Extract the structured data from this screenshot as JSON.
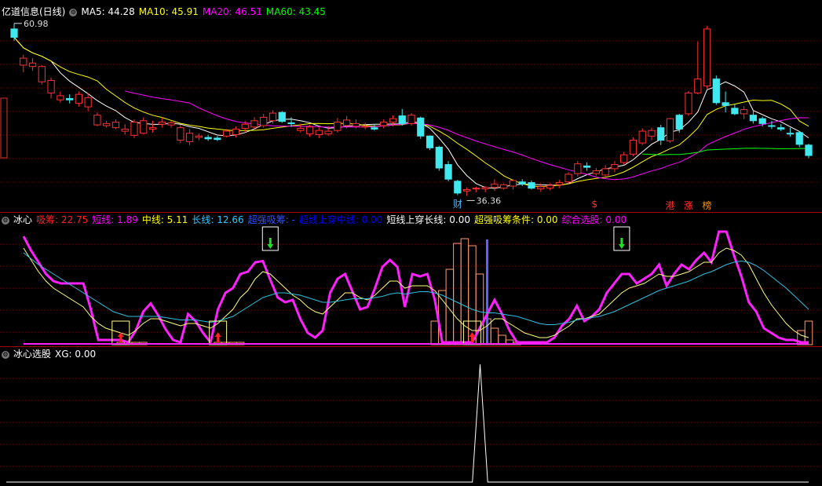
{
  "main_panel": {
    "title": "亿道信息(日线)",
    "indicators": [
      {
        "label": "MA5: 44.28",
        "color": "#ffffff"
      },
      {
        "label": "MA10: 45.91",
        "color": "#ffff00"
      },
      {
        "label": "MA20: 46.51",
        "color": "#ff00ff"
      },
      {
        "label": "MA60: 43.45",
        "color": "#00ff00"
      }
    ],
    "high_label": "60.98",
    "low_label": "36.36",
    "markers": [
      {
        "text": "财",
        "color": "#4db8ff"
      },
      {
        "text": "$",
        "color": "#ff3030"
      },
      {
        "text": "港",
        "color": "#ff3030"
      },
      {
        "text": "涨",
        "color": "#ff3030"
      },
      {
        "text": "榜",
        "color": "#ff9000"
      }
    ]
  },
  "sub_panel_1": {
    "title": "冰心",
    "indicators": [
      {
        "label": "吸筹: 22.75",
        "color": "#ff2020"
      },
      {
        "label": "短线: 1.89",
        "color": "#ff00ff"
      },
      {
        "label": "中线: 5.11",
        "color": "#ffff00"
      },
      {
        "label": "长线: 12.66",
        "color": "#30c8ff"
      },
      {
        "label": "超强吸筹: -",
        "color": "#3050ff"
      },
      {
        "label": "超线上穿中线: 0.00",
        "color": "#0000ff"
      },
      {
        "label": "短线上穿长线: 0.00",
        "color": "#ffffff"
      },
      {
        "label": "超强吸筹条件: 0.00",
        "color": "#ffff00"
      },
      {
        "label": "综合选股: 0.00",
        "color": "#ff00ff"
      }
    ]
  },
  "sub_panel_2": {
    "title": "冰心选股",
    "indicators": [
      {
        "label": "XG: 0.00",
        "color": "#ffffff"
      }
    ]
  },
  "chart_data": [
    {
      "type": "candlestick",
      "ohlc": [
        [
          60.2,
          61.0,
          58.5,
          59.0
        ],
        [
          55.0,
          56.5,
          54.0,
          56.0
        ],
        [
          54.8,
          56.0,
          54.2,
          55.3
        ],
        [
          52.6,
          55.0,
          52.2,
          54.8
        ],
        [
          51.0,
          53.2,
          50.2,
          52.8
        ],
        [
          50.0,
          51.2,
          49.6,
          50.6
        ],
        [
          50.2,
          50.8,
          49.5,
          50.0
        ],
        [
          49.5,
          51.2,
          49.0,
          50.8
        ],
        [
          49.0,
          51.0,
          48.4,
          50.3
        ],
        [
          46.4,
          48.2,
          46.2,
          47.8
        ],
        [
          46.3,
          47.0,
          46.0,
          46.6
        ],
        [
          46.0,
          47.2,
          45.8,
          46.8
        ],
        [
          45.5,
          46.5,
          45.0,
          45.8
        ],
        [
          44.9,
          47.2,
          44.5,
          46.8
        ],
        [
          45.2,
          47.5,
          45.0,
          47.0
        ],
        [
          45.8,
          47.0,
          45.3,
          46.0
        ],
        [
          46.5,
          47.5,
          46.0,
          46.8
        ],
        [
          46.4,
          47.0,
          46.0,
          46.7
        ],
        [
          44.2,
          46.4,
          43.8,
          46.0
        ],
        [
          44.0,
          45.8,
          43.5,
          45.2
        ],
        [
          44.6,
          45.2,
          44.2,
          44.8
        ],
        [
          44.6,
          45.0,
          44.1,
          44.4
        ],
        [
          44.5,
          44.8,
          44.1,
          44.3
        ],
        [
          44.8,
          45.8,
          44.6,
          45.5
        ],
        [
          45.0,
          46.2,
          44.6,
          45.8
        ],
        [
          45.9,
          47.0,
          45.3,
          46.5
        ],
        [
          46.1,
          47.5,
          45.8,
          47.0
        ],
        [
          46.3,
          48.0,
          46.0,
          47.5
        ],
        [
          47.0,
          48.5,
          46.6,
          48.1
        ],
        [
          48.2,
          48.4,
          46.7,
          46.9
        ],
        [
          46.7,
          47.5,
          46.1,
          46.6
        ],
        [
          45.6,
          46.6,
          45.3,
          45.9
        ],
        [
          45.1,
          46.4,
          44.7,
          46.1
        ],
        [
          45.0,
          46.1,
          44.5,
          45.6
        ],
        [
          45.1,
          46.2,
          44.8,
          45.5
        ],
        [
          45.6,
          47.4,
          45.3,
          46.8
        ],
        [
          46.3,
          47.7,
          45.9,
          47.1
        ],
        [
          46.2,
          47.2,
          45.9,
          46.6
        ],
        [
          46.2,
          46.7,
          45.8,
          46.2
        ],
        [
          46.0,
          46.5,
          45.6,
          45.8
        ],
        [
          46.3,
          47.2,
          45.9,
          46.8
        ],
        [
          46.8,
          47.8,
          46.2,
          47.3
        ],
        [
          47.7,
          48.7,
          46.3,
          46.6
        ],
        [
          46.6,
          48.1,
          46.3,
          47.8
        ],
        [
          47.4,
          47.6,
          44.4,
          44.8
        ],
        [
          44.8,
          44.9,
          42.8,
          43.1
        ],
        [
          43.2,
          43.4,
          39.8,
          40.2
        ],
        [
          40.7,
          41.2,
          38.3,
          38.6
        ],
        [
          38.3,
          38.5,
          36.3,
          36.6
        ],
        [
          36.9,
          37.4,
          36.2,
          37.1
        ],
        [
          37.3,
          37.5,
          36.7,
          37.3
        ],
        [
          37.2,
          37.6,
          36.7,
          37.4
        ],
        [
          37.4,
          38.6,
          36.9,
          37.9
        ],
        [
          37.3,
          38.0,
          37.1,
          37.8
        ],
        [
          37.6,
          38.6,
          37.1,
          38.4
        ],
        [
          38.2,
          38.6,
          37.6,
          37.9
        ],
        [
          38.1,
          38.4,
          37.1,
          37.3
        ],
        [
          37.2,
          38.0,
          36.8,
          37.5
        ],
        [
          37.3,
          38.0,
          37.0,
          37.7
        ],
        [
          37.8,
          38.5,
          37.3,
          38.1
        ],
        [
          38.2,
          39.6,
          37.9,
          39.3
        ],
        [
          39.4,
          41.2,
          39.0,
          40.8
        ],
        [
          40.5,
          41.0,
          39.8,
          40.3
        ],
        [
          39.4,
          40.2,
          39.1,
          39.8
        ],
        [
          39.2,
          40.6,
          38.7,
          40.1
        ],
        [
          40.1,
          41.2,
          39.6,
          40.7
        ],
        [
          41.0,
          42.5,
          40.7,
          42.1
        ],
        [
          42.2,
          44.6,
          41.9,
          44.2
        ],
        [
          43.8,
          45.9,
          43.5,
          45.5
        ],
        [
          44.8,
          46.0,
          44.2,
          45.6
        ],
        [
          46.0,
          46.4,
          43.5,
          44.2
        ],
        [
          44.1,
          47.4,
          43.8,
          47.3
        ],
        [
          47.8,
          48.0,
          45.3,
          45.8
        ],
        [
          48.0,
          51.3,
          47.7,
          51.0
        ],
        [
          51.0,
          58.4,
          50.8,
          53.0
        ],
        [
          52.0,
          60.6,
          51.6,
          60.2
        ],
        [
          53.0,
          53.5,
          49.3,
          49.6
        ],
        [
          49.6,
          51.2,
          48.2,
          49.2
        ],
        [
          48.8,
          49.4,
          47.8,
          48.0
        ],
        [
          48.0,
          49.1,
          47.2,
          48.6
        ],
        [
          47.8,
          48.6,
          46.6,
          47.0
        ],
        [
          47.3,
          47.6,
          46.2,
          46.6
        ],
        [
          46.3,
          47.0,
          45.8,
          46.2
        ],
        [
          46.0,
          46.5,
          45.5,
          45.8
        ],
        [
          45.2,
          46.0,
          44.7,
          45.1
        ],
        [
          45.3,
          45.5,
          43.2,
          43.6
        ],
        [
          43.5,
          43.7,
          41.6,
          42.0
        ]
      ],
      "ma": {
        "MA5": 44.28,
        "MA10": 45.91,
        "MA20": 46.51,
        "MA60": 43.45
      },
      "high": 60.98,
      "low": 36.36
    },
    {
      "type": "line",
      "series": [
        {
          "name": "短线",
          "values": [
            92,
            80,
            70,
            60,
            54,
            52,
            52,
            52,
            52,
            30,
            4,
            4,
            4,
            4,
            2,
            12,
            28,
            35,
            25,
            13,
            4,
            2,
            26,
            20,
            10,
            2,
            30,
            44,
            48,
            60,
            62,
            70,
            71,
            55,
            40,
            36,
            38,
            22,
            10,
            6,
            12,
            44,
            56,
            60,
            45,
            30,
            32,
            48,
            66,
            72,
            66,
            32,
            60,
            58,
            60,
            38,
            2,
            2,
            2,
            2,
            2,
            14,
            26,
            38,
            26,
            12,
            2,
            2,
            2,
            2,
            2,
            6,
            16,
            22,
            33,
            20,
            24,
            30,
            44,
            52,
            60,
            60,
            52,
            56,
            60,
            68,
            50,
            60,
            68,
            64,
            72,
            78,
            70,
            96,
            96,
            76,
            58,
            36,
            28,
            14,
            10,
            6,
            4,
            4,
            2,
            2
          ]
        },
        {
          "name": "中线",
          "values": [
            82,
            72,
            62,
            54,
            48,
            44,
            40,
            36,
            32,
            24,
            18,
            14,
            12,
            10,
            8,
            12,
            18,
            22,
            22,
            20,
            18,
            16,
            18,
            18,
            16,
            14,
            18,
            24,
            30,
            40,
            46,
            56,
            62,
            60,
            54,
            48,
            42,
            38,
            32,
            28,
            26,
            32,
            38,
            44,
            44,
            40,
            38,
            42,
            48,
            54,
            54,
            48,
            50,
            50,
            50,
            46,
            38,
            30,
            22,
            16,
            12,
            12,
            16,
            22,
            22,
            18,
            14,
            10,
            8,
            6,
            6,
            8,
            12,
            16,
            22,
            22,
            24,
            26,
            32,
            38,
            44,
            48,
            50,
            52,
            56,
            60,
            58,
            58,
            60,
            62,
            66,
            70,
            70,
            78,
            82,
            80,
            76,
            68,
            56,
            44,
            34,
            26,
            18,
            12,
            8,
            6
          ]
        },
        {
          "name": "长线",
          "values": [
            78,
            73,
            68,
            64,
            60,
            56,
            52,
            48,
            44,
            40,
            36,
            32,
            28,
            26,
            24,
            24,
            24,
            24,
            24,
            23,
            22,
            21,
            21,
            21,
            20,
            19,
            20,
            22,
            24,
            28,
            32,
            36,
            40,
            42,
            44,
            44,
            43,
            42,
            40,
            38,
            36,
            36,
            37,
            38,
            39,
            39,
            39,
            40,
            41,
            43,
            44,
            43,
            44,
            45,
            45,
            44,
            42,
            39,
            36,
            33,
            30,
            28,
            27,
            27,
            26,
            25,
            24,
            22,
            20,
            18,
            17,
            17,
            18,
            19,
            21,
            22,
            23,
            24,
            26,
            28,
            31,
            34,
            37,
            40,
            43,
            46,
            48,
            50,
            52,
            54,
            57,
            60,
            62,
            65,
            68,
            70,
            71,
            70,
            67,
            63,
            58,
            53,
            48,
            42,
            36,
            30
          ]
        }
      ],
      "bars": [
        0,
        0,
        0,
        0,
        0,
        0,
        0,
        0,
        0,
        0,
        0,
        0,
        0,
        2,
        2,
        2,
        2,
        0,
        0,
        0,
        0,
        0,
        0,
        0,
        0,
        0,
        2,
        2,
        2,
        2,
        0,
        0,
        0,
        0,
        0,
        0,
        0,
        0,
        0,
        0,
        0,
        0,
        0,
        0,
        0,
        0,
        0,
        0,
        0,
        0,
        0,
        0,
        0,
        0,
        0,
        20,
        46,
        64,
        86,
        90,
        84,
        60,
        22,
        14,
        8,
        4,
        2,
        0,
        0,
        0,
        0,
        0,
        0,
        0,
        0,
        0,
        0,
        0,
        0,
        0,
        0,
        0,
        0,
        0,
        0,
        0,
        0,
        0,
        0,
        0,
        0,
        0,
        0,
        0,
        0,
        0,
        0,
        0,
        0,
        0,
        0,
        0,
        0,
        0,
        12,
        20
      ]
    },
    {
      "type": "line",
      "series": [
        {
          "name": "XG",
          "values": [
            0,
            0,
            0,
            0,
            0,
            0,
            0,
            0,
            0,
            0,
            0,
            0,
            0,
            0,
            0,
            0,
            0,
            0,
            0,
            0,
            0,
            0,
            0,
            0,
            0,
            0,
            0,
            0,
            0,
            0,
            0,
            0,
            0,
            0,
            0,
            0,
            0,
            0,
            0,
            0,
            0,
            0,
            0,
            0,
            0,
            0,
            0,
            0,
            0,
            0,
            0,
            0,
            0,
            0,
            0,
            0,
            0,
            0,
            0,
            0,
            0,
            0,
            1,
            0,
            0,
            0,
            0,
            0,
            0,
            0,
            0,
            0,
            0,
            0,
            0,
            0,
            0,
            0,
            0,
            0,
            0,
            0,
            0,
            0,
            0,
            0,
            0,
            0,
            0,
            0,
            0,
            0,
            0,
            0,
            0,
            0,
            0,
            0,
            0,
            0,
            0,
            0,
            0,
            0,
            0,
            0
          ]
        }
      ]
    }
  ]
}
